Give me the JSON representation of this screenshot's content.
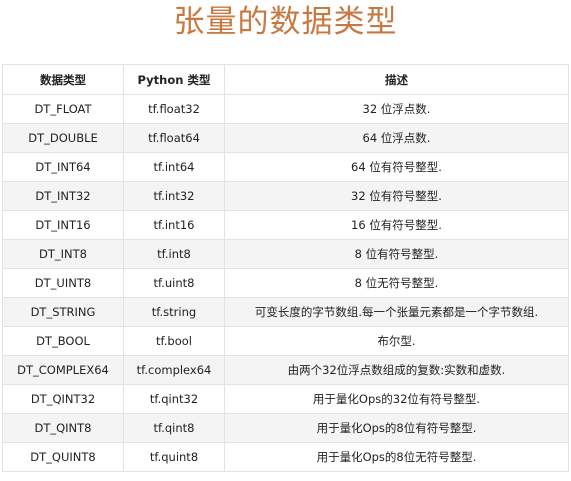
{
  "title": "张量的数据类型",
  "table": {
    "headers": [
      "数据类型",
      "Python 类型",
      "描述"
    ],
    "rows": [
      [
        "DT_FLOAT",
        "tf.float32",
        "32 位浮点数."
      ],
      [
        "DT_DOUBLE",
        "tf.float64",
        "64 位浮点数."
      ],
      [
        "DT_INT64",
        "tf.int64",
        "64 位有符号整型."
      ],
      [
        "DT_INT32",
        "tf.int32",
        "32 位有符号整型."
      ],
      [
        "DT_INT16",
        "tf.int16",
        "16 位有符号整型."
      ],
      [
        "DT_INT8",
        "tf.int8",
        "8 位有符号整型."
      ],
      [
        "DT_UINT8",
        "tf.uint8",
        "8 位无符号整型."
      ],
      [
        "DT_STRING",
        "tf.string",
        "可变长度的字节数组.每一个张量元素都是一个字节数组."
      ],
      [
        "DT_BOOL",
        "tf.bool",
        "布尔型."
      ],
      [
        "DT_COMPLEX64",
        "tf.complex64",
        "由两个32位浮点数组成的复数:实数和虚数."
      ],
      [
        "DT_QINT32",
        "tf.qint32",
        "用于量化Ops的32位有符号整型."
      ],
      [
        "DT_QINT8",
        "tf.qint8",
        "用于量化Ops的8位有符号整型."
      ],
      [
        "DT_QUINT8",
        "tf.quint8",
        "用于量化Ops的8位无符号整型."
      ]
    ]
  }
}
